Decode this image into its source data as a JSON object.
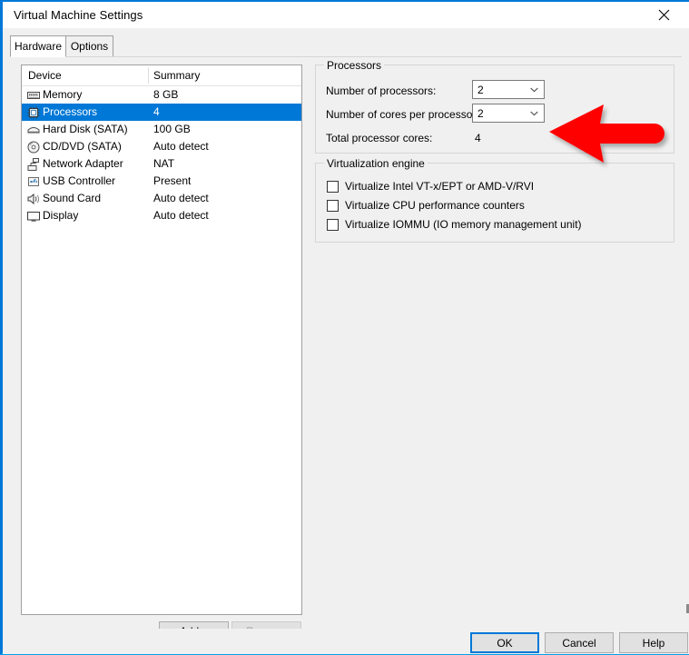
{
  "window": {
    "title": "Virtual Machine Settings",
    "close_icon": "close-icon",
    "accent_color": "#0078d7",
    "bottom_border_color": "#00a2e8"
  },
  "tabs": [
    {
      "label": "Hardware",
      "active": true
    },
    {
      "label": "Options",
      "active": false
    }
  ],
  "device_list": {
    "columns": [
      "Device",
      "Summary"
    ],
    "rows": [
      {
        "icon": "memory-icon",
        "device": "Memory",
        "summary": "8 GB",
        "selected": false
      },
      {
        "icon": "processor-icon",
        "device": "Processors",
        "summary": "4",
        "selected": true
      },
      {
        "icon": "hard-disk-icon",
        "device": "Hard Disk (SATA)",
        "summary": "100 GB",
        "selected": false
      },
      {
        "icon": "cd-dvd-icon",
        "device": "CD/DVD (SATA)",
        "summary": "Auto detect",
        "selected": false
      },
      {
        "icon": "network-adapter-icon",
        "device": "Network Adapter",
        "summary": "NAT",
        "selected": false
      },
      {
        "icon": "usb-controller-icon",
        "device": "USB Controller",
        "summary": "Present",
        "selected": false
      },
      {
        "icon": "sound-card-icon",
        "device": "Sound Card",
        "summary": "Auto detect",
        "selected": false
      },
      {
        "icon": "display-icon",
        "device": "Display",
        "summary": "Auto detect",
        "selected": false
      }
    ],
    "selection_color": "#0078d7"
  },
  "list_buttons": {
    "add_label": "Add...",
    "remove_label": "Remove",
    "remove_disabled": true
  },
  "processors_group": {
    "title": "Processors",
    "num_processors_label": "Number of processors:",
    "num_processors_value": "2",
    "num_cores_label": "Number of cores per processor:",
    "num_cores_value": "2",
    "total_cores_label": "Total processor cores:",
    "total_cores_value": "4"
  },
  "virtualization_group": {
    "title": "Virtualization engine",
    "checkboxes": [
      {
        "label": "Virtualize Intel VT-x/EPT or AMD-V/RVI",
        "checked": false
      },
      {
        "label": "Virtualize CPU performance counters",
        "checked": false
      },
      {
        "label": "Virtualize IOMMU (IO memory management unit)",
        "checked": false
      }
    ]
  },
  "annotation": {
    "name": "red-arrow-pointing-left",
    "color": "#ff0000",
    "points_at": "Number of cores per processor dropdown"
  },
  "dialog_buttons": {
    "ok_label": "OK",
    "cancel_label": "Cancel",
    "help_label": "Help",
    "default_button": "OK"
  }
}
